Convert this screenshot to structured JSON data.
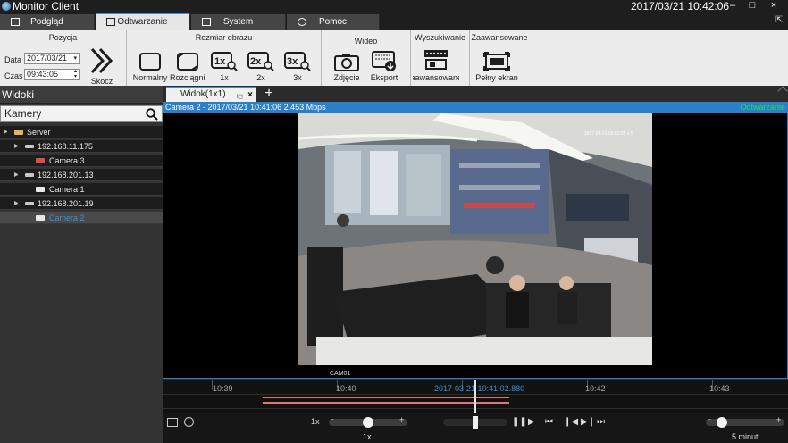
{
  "window": {
    "title": "Monitor Client",
    "datetime": "2017/03/21 10:42:06",
    "minimize": "–",
    "maximize": "□",
    "close": "×"
  },
  "main_tabs": [
    {
      "label": "Podgląd",
      "icon": "monitor-icon",
      "active": false
    },
    {
      "label": "Odtwarzanie",
      "icon": "playback-icon",
      "active": true
    },
    {
      "label": "System",
      "icon": "folder-icon",
      "active": false
    },
    {
      "label": "Pomoc",
      "icon": "help-icon",
      "active": false
    }
  ],
  "ribbon": {
    "pozycja": {
      "title": "Pozycja",
      "date_label": "Data",
      "date_value": "2017/03/21",
      "time_label": "Czas",
      "time_value": "09:43:05",
      "jump_label": "Skocz"
    },
    "rozmiar": {
      "title": "Rozmiar obrazu",
      "buttons": [
        "Normalny",
        "Rozciągnięty",
        "1x",
        "2x",
        "3x"
      ],
      "icon_text": [
        "",
        "",
        "1x",
        "2x",
        "3x"
      ]
    },
    "wideo": {
      "title": "Wideo",
      "buttons": [
        "Zdjęcie",
        "Eksport"
      ]
    },
    "wyszukiwanie": {
      "title": "Wyszukiwanie",
      "button": "Zaawansowane"
    },
    "zaawansowane": {
      "title": "Zaawansowane",
      "button": "Pełny ekran"
    }
  },
  "left_panel": {
    "header": "Widoki",
    "search_value": "Kamery",
    "tree": [
      {
        "label": "Server",
        "level": 0,
        "type": "server"
      },
      {
        "label": "192.168.11.175",
        "level": 1,
        "type": "nvr"
      },
      {
        "label": "Camera 3",
        "level": 2,
        "type": "camera-red"
      },
      {
        "label": "192.168.201.13",
        "level": 1,
        "type": "nvr"
      },
      {
        "label": "Camera 1",
        "level": 2,
        "type": "camera"
      },
      {
        "label": "192.168.201.19",
        "level": 1,
        "type": "nvr"
      },
      {
        "label": "Camera 2",
        "level": 2,
        "type": "camera",
        "selected": true
      }
    ]
  },
  "view_tab": {
    "label": "Widok(1x1)",
    "add": "+"
  },
  "video": {
    "info": "Camera 2 - 2017/03/21 10:41:06 2.453 Mbps",
    "status": "Odtwarzanie",
    "status_color": "#2fd75a",
    "accent": "#2a7fc9",
    "cam_overlay_ts": "2017-03-21 09:52:05 ≡ 5",
    "cam_label": "CAM01"
  },
  "timeline": {
    "ticks": [
      "10:39",
      "10:40",
      "10:41",
      "10:42",
      "10:43"
    ],
    "current_time": "2017-03-21   10:41:02.880",
    "current_time_color": "#3a8fd6"
  },
  "controls": {
    "speed_label": "1x",
    "speed_value": "1x",
    "zoom_value": "5 minut",
    "minus": "-",
    "plus": "+"
  }
}
